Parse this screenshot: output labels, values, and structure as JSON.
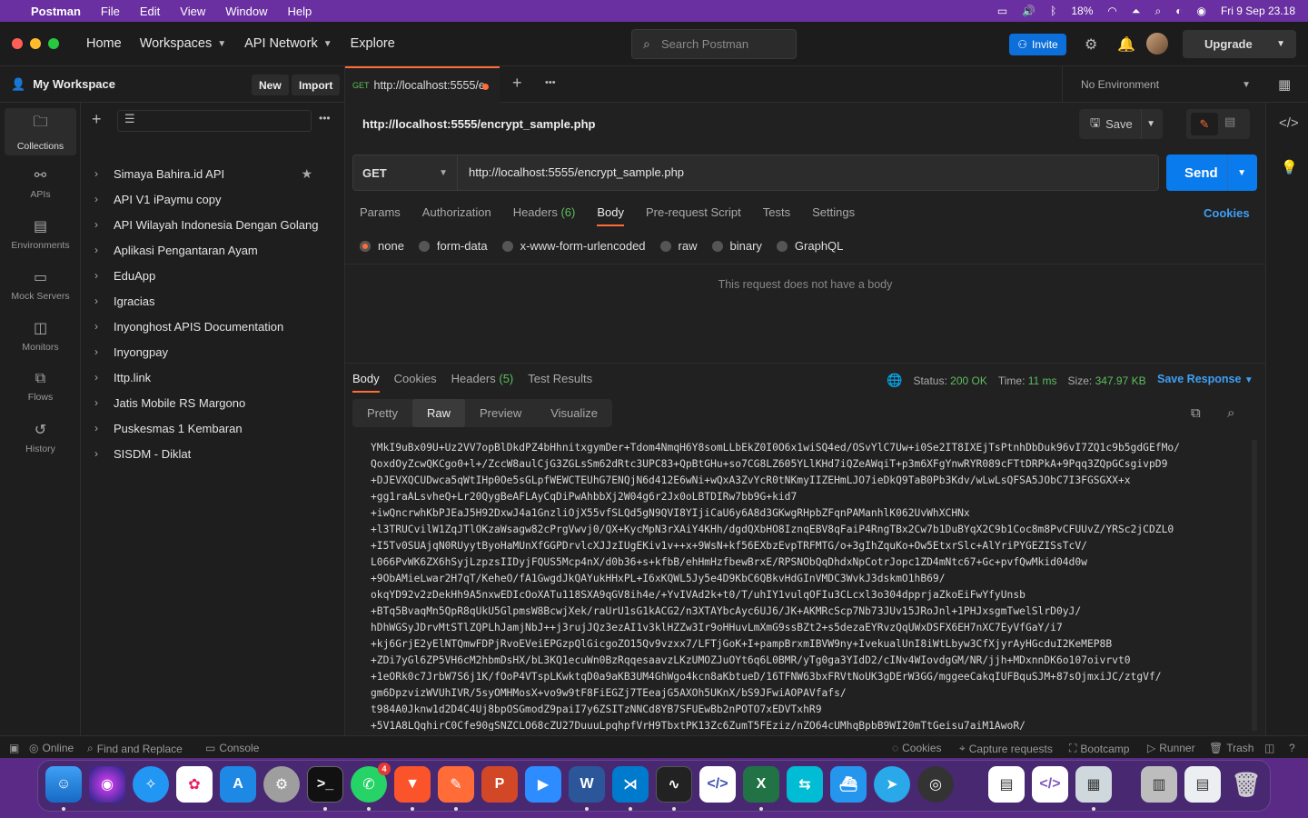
{
  "menubar": {
    "app": "Postman",
    "items": [
      "File",
      "Edit",
      "View",
      "Window",
      "Help"
    ],
    "battery": "18%",
    "clock": "Fri 9 Sep  23.18"
  },
  "titlebar": {
    "nav": [
      "Home",
      "Workspaces",
      "API Network",
      "Explore"
    ],
    "search_placeholder": "Search Postman",
    "invite": "Invite",
    "upgrade": "Upgrade"
  },
  "workspace": {
    "title": "My Workspace",
    "new_btn": "New",
    "import_btn": "Import"
  },
  "rail": [
    "Collections",
    "APIs",
    "Environments",
    "Mock Servers",
    "Monitors",
    "Flows",
    "History"
  ],
  "collections": [
    "Simaya Bahira.id API",
    "API V1 iPaymu copy",
    "API Wilayah Indonesia Dengan Golang",
    "Aplikasi Pengantaran Ayam",
    "EduApp",
    "Igracias",
    "Inyonghost APIS Documentation",
    "Inyongpay",
    "Ittp.link",
    "Jatis Mobile RS Margono",
    "Puskesmas 1 Kembaran",
    "SISDM - Diklat"
  ],
  "tab": {
    "method": "GET",
    "label": "http://localhost:5555/e",
    "environment": "No Environment"
  },
  "request": {
    "title": "http://localhost:5555/encrypt_sample.php",
    "save": "Save",
    "method": "GET",
    "url": "http://localhost:5555/encrypt_sample.php",
    "send": "Send",
    "tabs": [
      {
        "label": "Params",
        "count": ""
      },
      {
        "label": "Authorization",
        "count": ""
      },
      {
        "label": "Headers",
        "count": "(6)"
      },
      {
        "label": "Body",
        "count": ""
      },
      {
        "label": "Pre-request Script",
        "count": ""
      },
      {
        "label": "Tests",
        "count": ""
      },
      {
        "label": "Settings",
        "count": ""
      }
    ],
    "cookies": "Cookies",
    "body_types": [
      "none",
      "form-data",
      "x-www-form-urlencoded",
      "raw",
      "binary",
      "GraphQL"
    ],
    "no_body": "This request does not have a body"
  },
  "response": {
    "tabs": [
      {
        "label": "Body",
        "count": ""
      },
      {
        "label": "Cookies",
        "count": ""
      },
      {
        "label": "Headers",
        "count": "(5)"
      },
      {
        "label": "Test Results",
        "count": ""
      }
    ],
    "status_label": "Status:",
    "status": "200 OK",
    "time_label": "Time:",
    "time": "11 ms",
    "size_label": "Size:",
    "size": "347.97 KB",
    "save_response": "Save Response",
    "views": [
      "Pretty",
      "Raw",
      "Preview",
      "Visualize"
    ],
    "raw_lines": [
      "YMkI9uBx09U+Uz2VV7opBlDkdPZ4bHhnitxgymDer+Tdom4NmqH6Y8somLLbEkZ0I0O6x1wiSQ4ed/OSvYlC7Uw+i0Se2IT8IXEjTsPtnhDbDuk96vI7ZQ1c9b5gdGEfMo/",
      "QoxdOyZcwQKCgo0+l+/ZccW8aulCjG3ZGLsSm62dRtc3UPC83+QpBtGHu+so7CG8LZ605YLlKHd7iQZeAWqiT+p3m6XFgYnwRYR089cFTtDRPkA+9Pqq3ZQpGCsgivpD9",
      "+DJEVXQCUDwca5qWtIHp0Oe5sGLpfWEWCTEUhG7ENQjN6d412E6wNi+wQxA3ZvYcR0tNKmyIIZEHmLJO7ieDkQ9TaB0Pb3Kdv/wLwLsQFSA5JObC7I3FGSGXX+x",
      "+gg1raALsvheQ+Lr20QygBeAFLAyCqDiPwAhbbXj2W04g6r2Jx0oLBTDIRw7bb9G+kid7",
      "+iwQncrwhKbPJEaJ5H92DxwJ4a1GnzliOjX55vfSLQd5gN9QVI8YIjiCaU6y6A8d3GKwgRHpbZFqnPAManhlK062UvWhXCHNx",
      "+l3TRUCvilW1ZqJTlOKzaWsagw82cPrgVwvj0/QX+KycMpN3rXAiY4KHh/dgdQXbHO8IznqEBV8qFaiP4RngTBx2Cw7b1DuBYqX2C9b1Coc8m8PvCFUUvZ/YRSc2jCDZL0",
      "+I5Tv0SUAjqN0RUyytByoHaMUnXfGGPDrvlcXJJzIUgEKiv1v++x+9WsN+kf56EXbzEvpTRFMTG/o+3gIhZquKo+Ow5EtxrSlc+AlYriPYGEZISsTcV/",
      "L066PvWK6ZX6hSyjLzpzsIIDyjFQUS5Mcp4nX/d0b36+s+kfbB/ehHmHzfbewBrxE/RPSNObQqDhdxNpCotrJopc1ZD4mNtc67+Gc+pvfQwMkid04d0w",
      "+9ObAMieLwar2H7qT/KeheO/fA1GwgdJkQAYukHHxPL+I6xKQWL5Jy5e4D9KbC6QBkvHdGInVMDC3WvkJ3dskmO1hB69/",
      "okqYD92v2zDekHh9A5nxwEDIcOoXATu118SXA9qGV8ih4e/+YvIVAd2k+t0/T/uhIY1vulqOFIu3CLcxl3o304dpprjaZkoEiFwYfyUnsb",
      "+BTq5BvaqMn5QpR8qUkU5GlpmsW8BcwjXek/raUrU1sG1kACG2/n3XTAYbcAyc6UJ6/JK+AKMRcScp7Nb73JUv15JRoJnl+1PHJxsgmTwelSlrD0yJ/",
      "hDhWGSyJDrvMtSTlZQPLhJamjNbJ++j3rujJQz3ezAI1v3klHZZw3Ir9oHHuvLmXmG9ssBZt2+s5dezaEYRvzQqUWxDSFX6EH7nXC7EyVfGaY/i7",
      "+kj6GrjE2yElNTQmwFDPjRvoEVeiEPGzpQlGicgoZO15Qv9vzxx7/LFTjGoK+I+pampBrxmIBVW9ny+IvekualUnI8iWtLbyw3CfXjyrAyHGcduI2KeMEP8B",
      "+ZDi7yGl6ZP5VH6cM2hbmDsHX/bL3KQ1ecuWn0BzRqqesaavzLKzUMOZJuOYt6q6L0BMR/yTg0ga3YIdD2/cINv4WIovdgGM/NR/jjh+MDxnnDK6o107oivrvt0",
      "+1eORk0c7JrbW7S6j1K/fOoP4VTspLKwktqD0a9aKB3UM4GhWgo4kcn8aKbtueD/16TFNW63bxFRVtNoUK3gDErW3GG/mggeeCakqIUFBquSJM+87sOjmxiJC/ztgVf/",
      "gm6DpzvizWVUhIVR/5syOMHMosX+vo9w9tF8FiEGZj7TEeajG5AXOh5UKnX/bS9JFwiAOPAVfafs/",
      "t984A0Jknw1d2D4C4Uj8bpOSGmodZ9paiI7y6ZSITzNNCd8YB7SFUEwBb2nPOTO7xEDVTxhR9",
      "+5V1A8LQqhirC0Cfe90gSNZCLO68cZU27DuuuLpqhpfVrH9TbxtPK13Zc6ZumT5FEziz/nZO64cUMhqBpbB9WI20mTtGeisu7aiM1AwoR/"
    ]
  },
  "statusbar": {
    "online": "Online",
    "find_replace": "Find and Replace",
    "console": "Console",
    "cookies": "Cookies",
    "capture": "Capture requests",
    "bootcamp": "Bootcamp",
    "runner": "Runner",
    "trash": "Trash"
  },
  "dock": {
    "whatsapp_badge": "4"
  },
  "colors": {
    "accent": "#ff6c37",
    "send": "#097bed",
    "success": "#5dbe5d",
    "link": "#3ea0f5"
  }
}
